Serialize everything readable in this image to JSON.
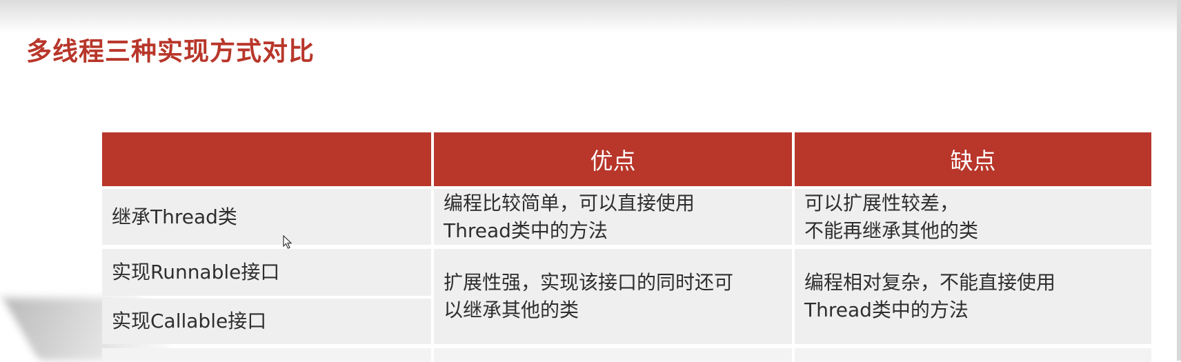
{
  "page": {
    "title": "多线程三种实现方式对比"
  },
  "table": {
    "headers": [
      "",
      "优点",
      "缺点"
    ],
    "rows": [
      {
        "method": "继承Thread类",
        "pros": [
          "编程比较简单，可以直接使用",
          "Thread类中的方法"
        ],
        "cons": [
          "可以扩展性较差，",
          "不能再继承其他的类"
        ]
      },
      {
        "methods": [
          "实现Runnable接口",
          "实现Callable接口"
        ],
        "pros": [
          "扩展性强，实现该接口的同时还可",
          "以继承其他的类"
        ],
        "cons": [
          "编程相对复杂，不能直接使用",
          "Thread类中的方法"
        ]
      }
    ]
  },
  "colors": {
    "accent": "#b8362a",
    "cell_background": "#efefef",
    "text": "#2e2e2e"
  },
  "icons": {
    "cursor": "mouse-pointer-icon"
  }
}
